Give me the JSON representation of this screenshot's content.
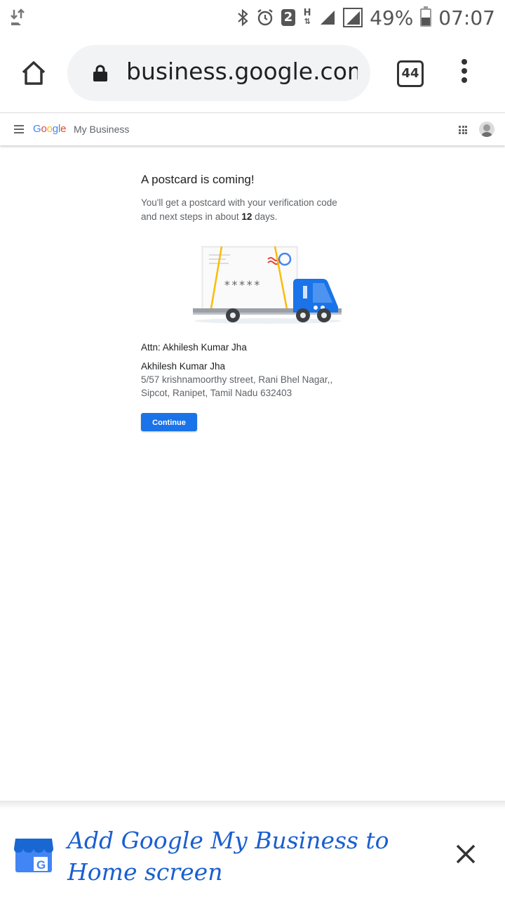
{
  "status_bar": {
    "battery_percent": "49%",
    "battery_level": 0.49,
    "time": "07:07",
    "notification_count": "2",
    "network_type": "H",
    "icons": [
      "data-transfer-icon",
      "bluetooth-icon",
      "alarm-icon",
      "notification-badge",
      "network-type-icon",
      "signal-icon",
      "signal-icon-2",
      "battery-icon"
    ]
  },
  "browser": {
    "url": "business.google.com/",
    "tab_count": "44",
    "icons": [
      "home-icon",
      "lock-icon",
      "tabs-icon",
      "more-vert-icon"
    ]
  },
  "gmb_header": {
    "logo_google": [
      "G",
      "o",
      "o",
      "g",
      "l",
      "e"
    ],
    "product_name": "My Business",
    "icons": [
      "menu-icon",
      "apps-icon",
      "avatar"
    ]
  },
  "main": {
    "title": "A postcard is coming!",
    "desc_line1": "You'll get a postcard with your verification code",
    "desc_line2_pre": "and next steps in about ",
    "desc_days": "12",
    "desc_line2_post": " days.",
    "illustration_code": "*****",
    "attn": "Attn: Akhilesh Kumar Jha",
    "addr_name": "Akhilesh Kumar Jha",
    "addr_line1": "5/57 krishnamoorthy street, Rani Bhel Nagar,,",
    "addr_line2": "Sipcot, Ranipet, Tamil Nadu 632403",
    "continue_label": "Continue"
  },
  "banner": {
    "text_line1": "Add Google My Business to",
    "text_line2": "Home screen",
    "icon_letter": "G",
    "icons": [
      "gmb-app-icon",
      "close-icon"
    ]
  },
  "colors": {
    "accent": "#1a73e8",
    "banner_text": "#1a5fd0",
    "google_blue": "#4285f4",
    "google_red": "#ea4335",
    "google_yellow": "#fbbc05",
    "google_green": "#34a853"
  }
}
